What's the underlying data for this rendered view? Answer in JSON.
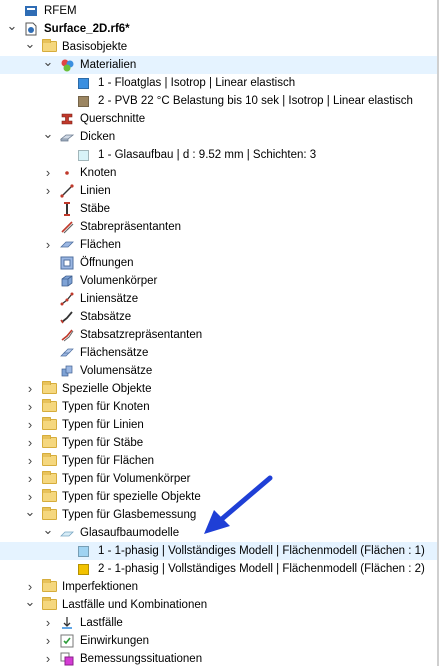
{
  "rows": [
    {
      "label": "RFEM",
      "depth": 0,
      "expand": "",
      "icon": "rfem-icon",
      "bold": false
    },
    {
      "label": "Surface_2D.rf6*",
      "depth": 0,
      "expand": "down",
      "icon": "model-file-icon",
      "bold": true
    },
    {
      "label": "Basisobjekte",
      "depth": 1,
      "expand": "down",
      "icon": "folder-icon",
      "bold": false
    },
    {
      "label": "Materialien",
      "depth": 2,
      "expand": "down",
      "icon": "materials-icon",
      "bold": false,
      "selected": true
    },
    {
      "label": "1 - Floatglas | Isotrop | Linear elastisch",
      "depth": 3,
      "expand": "",
      "icon": "color-square-icon",
      "color": "#3a8fe0",
      "bold": false
    },
    {
      "label": "2 - PVB 22 °C Belastung bis 10 sek | Isotrop | Linear elastisch",
      "depth": 3,
      "expand": "",
      "icon": "color-square-icon",
      "color": "#9c8662",
      "bold": false
    },
    {
      "label": "Querschnitte",
      "depth": 2,
      "expand": "",
      "icon": "cross-section-icon",
      "bold": false
    },
    {
      "label": "Dicken",
      "depth": 2,
      "expand": "down",
      "icon": "thickness-icon",
      "bold": false
    },
    {
      "label": "1 - Glasaufbau | d : 9.52 mm | Schichten: 3",
      "depth": 3,
      "expand": "",
      "icon": "color-square-icon",
      "color": "#d8f3f8",
      "bold": false
    },
    {
      "label": "Knoten",
      "depth": 2,
      "expand": "right",
      "icon": "node-icon",
      "bold": false
    },
    {
      "label": "Linien",
      "depth": 2,
      "expand": "right",
      "icon": "line-icon",
      "bold": false
    },
    {
      "label": "Stäbe",
      "depth": 2,
      "expand": "",
      "icon": "member-icon",
      "bold": false
    },
    {
      "label": "Stabrepräsentanten",
      "depth": 2,
      "expand": "",
      "icon": "member-representative-icon",
      "bold": false
    },
    {
      "label": "Flächen",
      "depth": 2,
      "expand": "right",
      "icon": "surface-icon",
      "bold": false
    },
    {
      "label": "Öffnungen",
      "depth": 2,
      "expand": "",
      "icon": "opening-icon",
      "bold": false
    },
    {
      "label": "Volumenkörper",
      "depth": 2,
      "expand": "",
      "icon": "solid-icon",
      "bold": false
    },
    {
      "label": "Liniensätze",
      "depth": 2,
      "expand": "",
      "icon": "line-set-icon",
      "bold": false
    },
    {
      "label": "Stabsätze",
      "depth": 2,
      "expand": "",
      "icon": "member-set-icon",
      "bold": false
    },
    {
      "label": "Stabsatzrepräsentanten",
      "depth": 2,
      "expand": "",
      "icon": "member-set-representative-icon",
      "bold": false
    },
    {
      "label": "Flächensätze",
      "depth": 2,
      "expand": "",
      "icon": "surface-set-icon",
      "bold": false
    },
    {
      "label": "Volumensätze",
      "depth": 2,
      "expand": "",
      "icon": "solid-set-icon",
      "bold": false
    },
    {
      "label": "Spezielle Objekte",
      "depth": 1,
      "expand": "right",
      "icon": "folder-icon",
      "bold": false
    },
    {
      "label": "Typen für Knoten",
      "depth": 1,
      "expand": "right",
      "icon": "folder-icon",
      "bold": false
    },
    {
      "label": "Typen für Linien",
      "depth": 1,
      "expand": "right",
      "icon": "folder-icon",
      "bold": false
    },
    {
      "label": "Typen für Stäbe",
      "depth": 1,
      "expand": "right",
      "icon": "folder-icon",
      "bold": false
    },
    {
      "label": "Typen für Flächen",
      "depth": 1,
      "expand": "right",
      "icon": "folder-icon",
      "bold": false
    },
    {
      "label": "Typen für Volumenkörper",
      "depth": 1,
      "expand": "right",
      "icon": "folder-icon",
      "bold": false
    },
    {
      "label": "Typen für spezielle Objekte",
      "depth": 1,
      "expand": "right",
      "icon": "folder-icon",
      "bold": false
    },
    {
      "label": "Typen für Glasbemessung",
      "depth": 1,
      "expand": "down",
      "icon": "folder-icon",
      "bold": false
    },
    {
      "label": "Glasaufbaumodelle",
      "depth": 2,
      "expand": "down",
      "icon": "glass-model-icon",
      "bold": false
    },
    {
      "label": "1 - 1-phasig | Vollständiges Modell | Flächenmodell (Flächen : 1)",
      "depth": 3,
      "expand": "",
      "icon": "color-square-icon",
      "color": "#9fd3f2",
      "bold": false,
      "selected": true
    },
    {
      "label": "2 - 1-phasig | Vollständiges Modell | Flächenmodell (Flächen : 2)",
      "depth": 3,
      "expand": "",
      "icon": "color-square-icon",
      "color": "#f2c200",
      "bold": false
    },
    {
      "label": "Imperfektionen",
      "depth": 1,
      "expand": "right",
      "icon": "folder-icon",
      "bold": false
    },
    {
      "label": "Lastfälle und Kombinationen",
      "depth": 1,
      "expand": "down",
      "icon": "folder-icon",
      "bold": false
    },
    {
      "label": "Lastfälle",
      "depth": 2,
      "expand": "right",
      "icon": "load-case-icon",
      "bold": false
    },
    {
      "label": "Einwirkungen",
      "depth": 2,
      "expand": "right",
      "icon": "action-icon",
      "bold": false
    },
    {
      "label": "Bemessungssituationen",
      "depth": 2,
      "expand": "right",
      "icon": "design-situation-icon",
      "bold": false
    }
  ],
  "colors": {
    "selection": "#e5f3ff",
    "arrow": "#1f3fd6",
    "folder": "#f5d77e"
  }
}
